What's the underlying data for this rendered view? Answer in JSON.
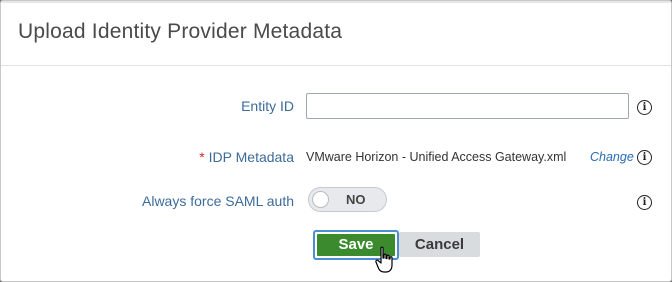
{
  "dialog": {
    "title": "Upload Identity Provider Metadata"
  },
  "form": {
    "entity_id": {
      "label": "Entity ID",
      "value": "",
      "placeholder": ""
    },
    "idp_metadata": {
      "required_marker": "*",
      "label": "IDP Metadata",
      "file_name": "VMware Horizon - Unified Access Gateway.xml",
      "change_link": "Change"
    },
    "force_saml": {
      "label": "Always force SAML auth",
      "toggle_state": "NO"
    },
    "info_icon_glyph": "i"
  },
  "actions": {
    "save_label": "Save",
    "cancel_label": "Cancel"
  },
  "colors": {
    "label_blue": "#3d6b9a",
    "save_green": "#3c8a2e",
    "focus_ring": "#4a8fd0",
    "link_blue": "#2a6cb3",
    "required_red": "#c03030"
  }
}
